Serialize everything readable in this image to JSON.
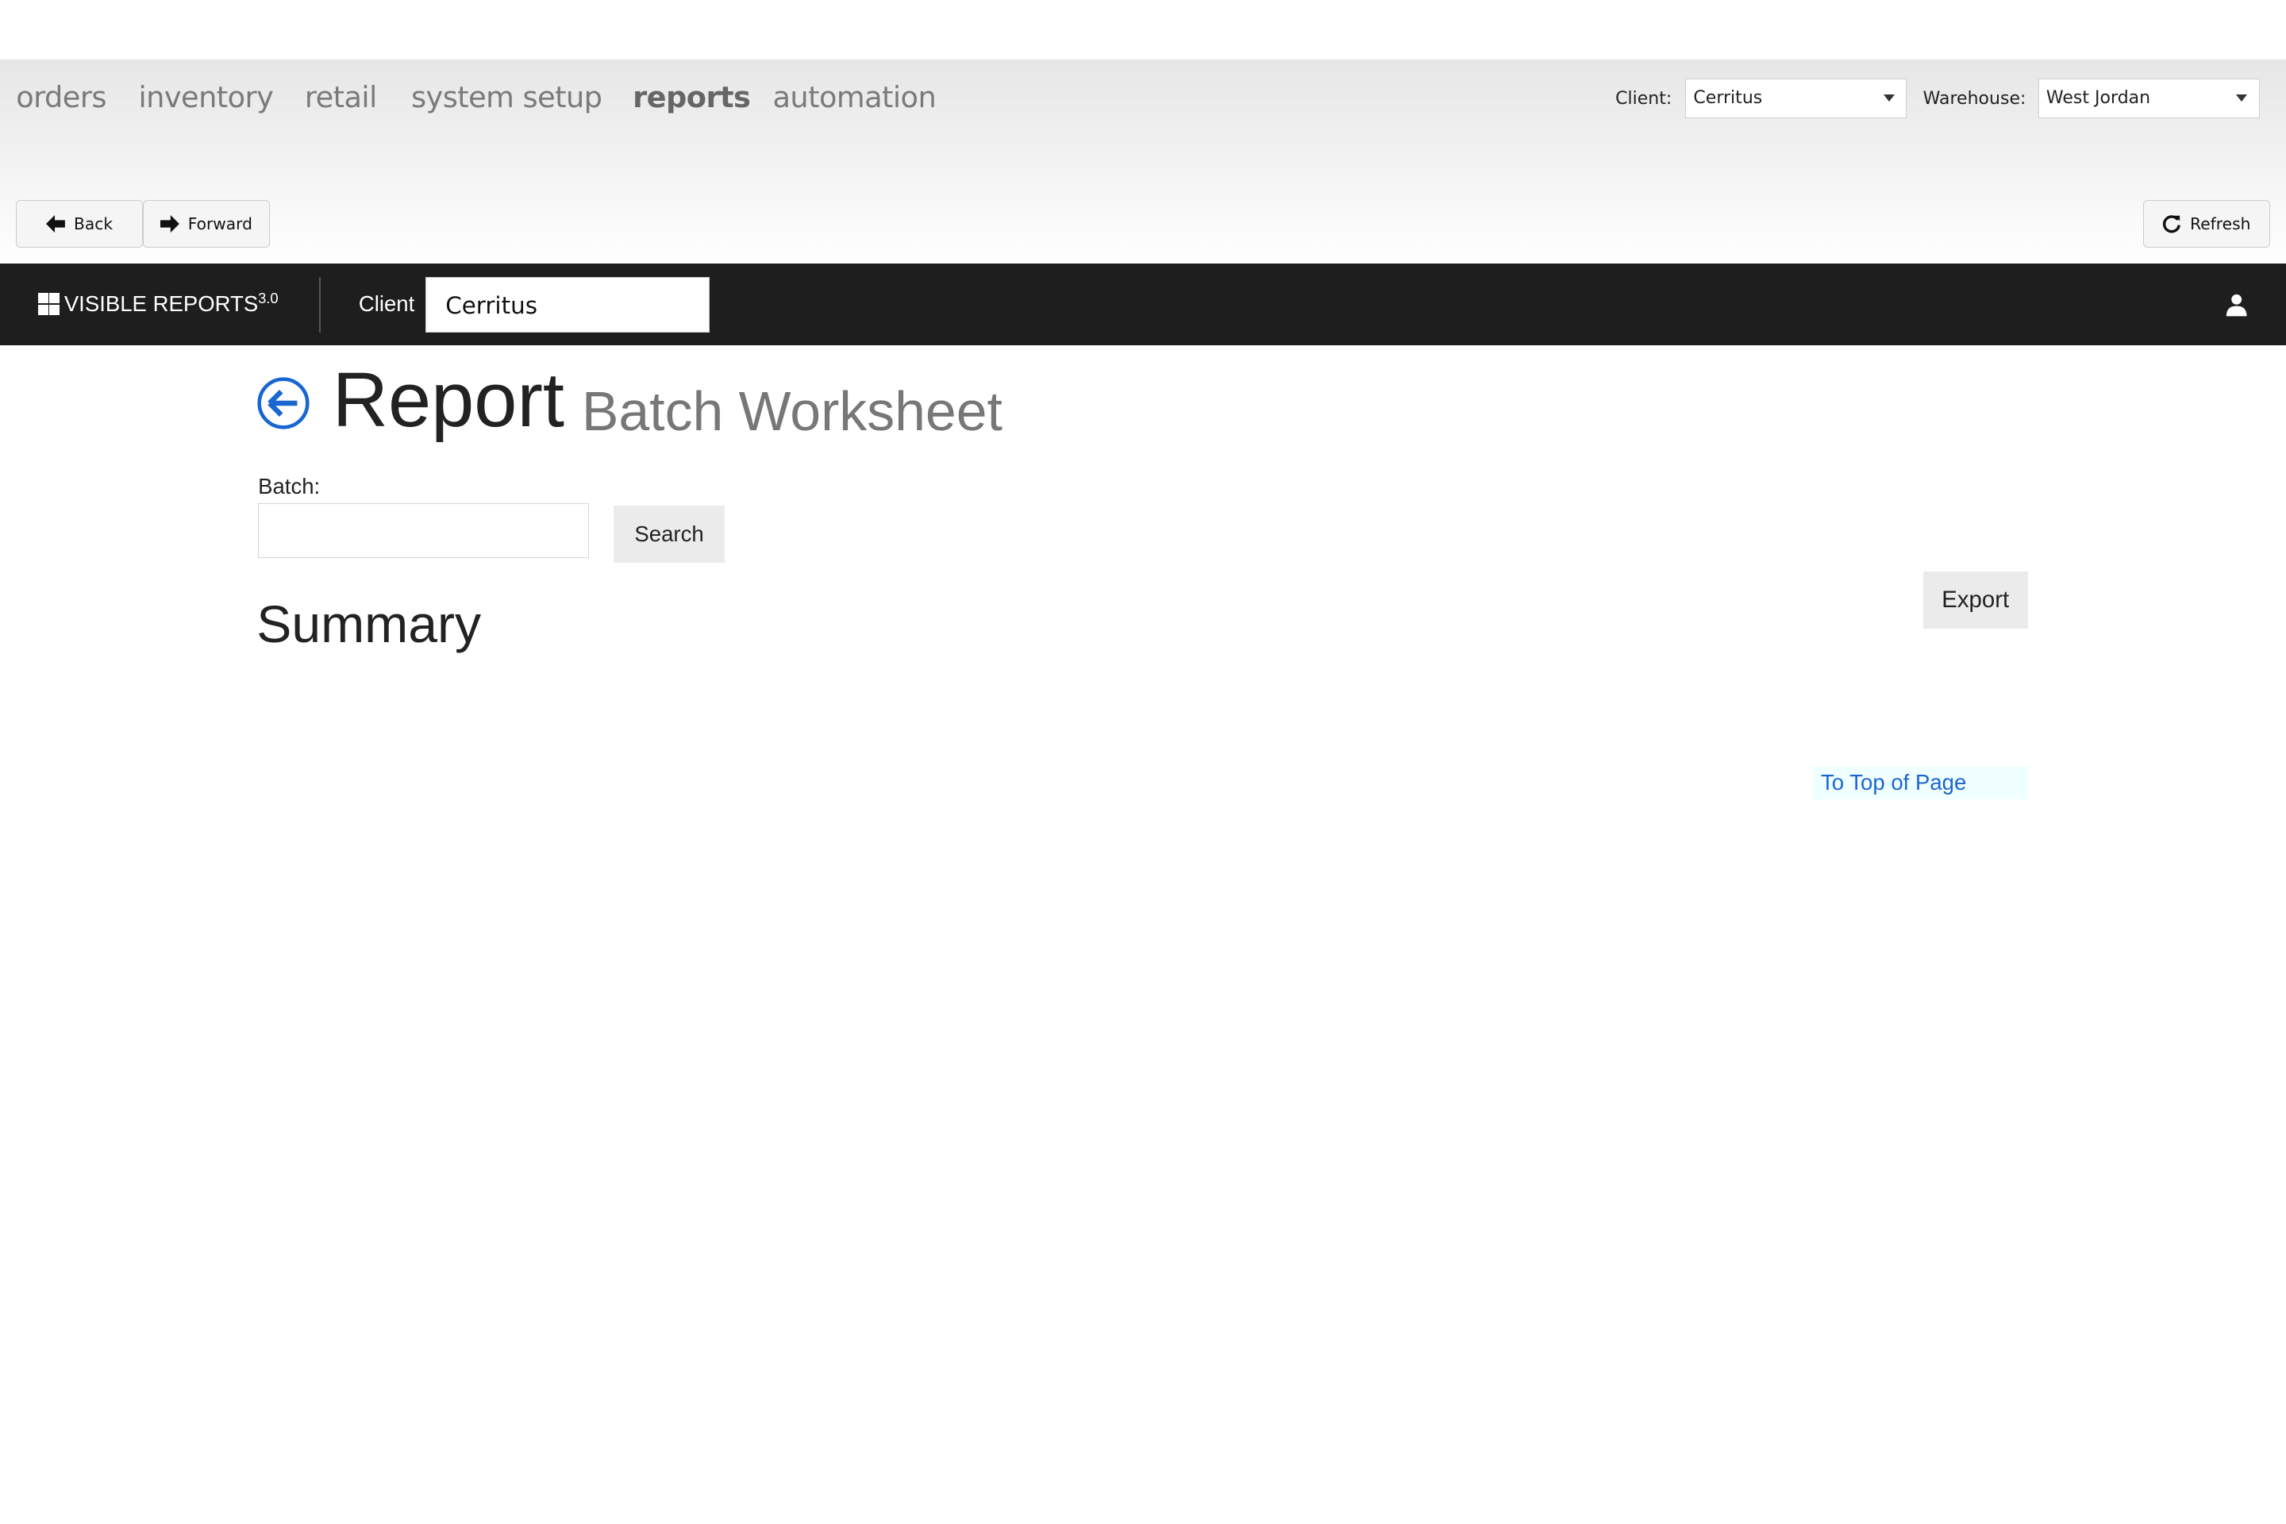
{
  "nav": {
    "items": [
      {
        "label": "orders",
        "active": false
      },
      {
        "label": "inventory",
        "active": false
      },
      {
        "label": "retail",
        "active": false
      },
      {
        "label": "system setup",
        "active": false
      },
      {
        "label": "reports",
        "active": true
      },
      {
        "label": "automation",
        "active": false
      }
    ],
    "client_label": "Client:",
    "client_value": "Cerritus",
    "warehouse_label": "Warehouse:",
    "warehouse_value": "West Jordan"
  },
  "toolbar": {
    "back": "Back",
    "forward": "Forward",
    "refresh": "Refresh"
  },
  "appbar": {
    "brand": "VISIBLE REPORTS",
    "version": "3.0",
    "client_label": "Client",
    "client_value": "Cerritus",
    "user_icon": "user-icon"
  },
  "report": {
    "title": "Report",
    "subtitle": "Batch Worksheet",
    "batch_label": "Batch:",
    "batch_value": "",
    "search": "Search",
    "summary": "Summary",
    "export": "Export",
    "to_top": "To Top of Page"
  },
  "colors": {
    "accent": "#1a66d0",
    "appbar": "#1e1e1e",
    "link": "#1a66d0"
  }
}
